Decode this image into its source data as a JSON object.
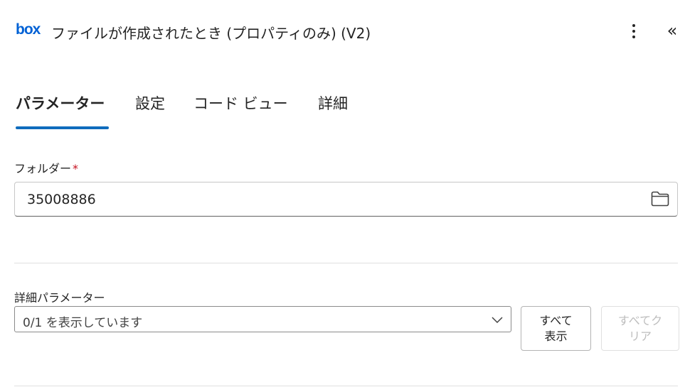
{
  "header": {
    "logo_text": "box",
    "title": "ファイルが作成されたとき (プロパティのみ) (V2)",
    "more_icon": "more-vertical-icon",
    "collapse_glyph": "«"
  },
  "tabs": [
    {
      "label": "パラメーター",
      "active": true
    },
    {
      "label": "設定",
      "active": false
    },
    {
      "label": "コード ビュー",
      "active": false
    },
    {
      "label": "詳細",
      "active": false
    }
  ],
  "folder": {
    "label": "フォルダー",
    "required_mark": "*",
    "value": "35008886",
    "icon": "folder-icon"
  },
  "advanced": {
    "label": "詳細パラメーター",
    "select_value": "0/1 を表示しています",
    "show_all_line1": "すべて",
    "show_all_line2": "表示",
    "clear_all_line1": "すべてク",
    "clear_all_line2": "リア",
    "clear_all_disabled": true
  },
  "colors": {
    "brand": "#0061d5",
    "accent": "#0f6cbd",
    "required": "#c50f1f"
  }
}
